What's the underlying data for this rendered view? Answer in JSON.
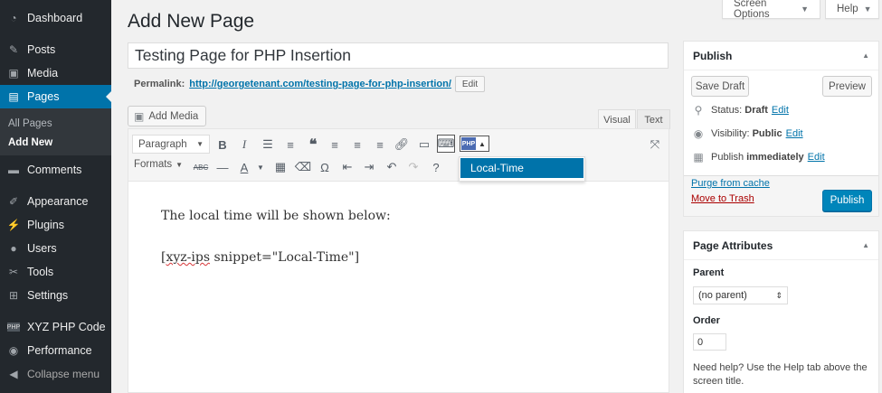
{
  "sidebar": {
    "items": [
      {
        "label": "Dashboard",
        "icon": "dashboard-icon"
      },
      {
        "label": "Posts",
        "icon": "pin-icon"
      },
      {
        "label": "Media",
        "icon": "media-icon"
      },
      {
        "label": "Pages",
        "icon": "pages-icon"
      },
      {
        "label": "Comments",
        "icon": "comments-icon"
      },
      {
        "label": "Appearance",
        "icon": "paintbrush-icon"
      },
      {
        "label": "Plugins",
        "icon": "plug-icon"
      },
      {
        "label": "Users",
        "icon": "users-icon"
      },
      {
        "label": "Tools",
        "icon": "wrench-icon"
      },
      {
        "label": "Settings",
        "icon": "settings-icon"
      },
      {
        "label": "XYZ PHP Code",
        "icon": "php-icon"
      },
      {
        "label": "Performance",
        "icon": "performance-icon"
      },
      {
        "label": "Collapse menu",
        "icon": "collapse-icon"
      }
    ],
    "submenu": [
      {
        "label": "All Pages"
      },
      {
        "label": "Add New"
      }
    ]
  },
  "top": {
    "screen_options": "Screen Options",
    "help": "Help"
  },
  "page_title": "Add New Page",
  "title_value": "Testing Page for PHP Insertion",
  "permalink": {
    "label": "Permalink:",
    "url": "http://georgetenant.com/testing-page-for-php-insertion/",
    "edit": "Edit"
  },
  "add_media": "Add Media",
  "editor_tabs": {
    "visual": "Visual",
    "text": "Text"
  },
  "toolbar": {
    "format": "Paragraph",
    "formats": "Formats",
    "php_badge": "PHP",
    "dropdown_option": "Local-Time"
  },
  "content": {
    "line1": "The local time will be shown below:",
    "line2_open": "[",
    "line2_misspelled": "xyz-ips",
    "line2_rest": " snippet=\"Local-Time\"]"
  },
  "publish": {
    "title": "Publish",
    "save_draft": "Save Draft",
    "preview": "Preview",
    "status_label": "Status:",
    "status_value": "Draft",
    "visibility_label": "Visibility:",
    "visibility_value": "Public",
    "publish_label": "Publish",
    "publish_value": "immediately",
    "edit": "Edit",
    "purge": "Purge from cache",
    "trash": "Move to Trash",
    "publish_button": "Publish"
  },
  "attributes": {
    "title": "Page Attributes",
    "parent_label": "Parent",
    "parent_value": "(no parent)",
    "order_label": "Order",
    "order_value": "0",
    "help": "Need help? Use the Help tab above the screen title."
  },
  "colors": {
    "sidebar_bg": "#23282d",
    "accent": "#0073aa",
    "publish_button": "#0085ba"
  }
}
